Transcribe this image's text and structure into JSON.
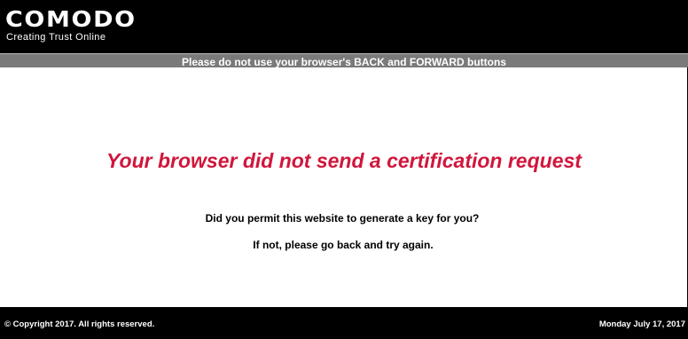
{
  "header": {
    "logo_text": "COMODO",
    "tagline": "Creating Trust Online"
  },
  "notice_bar": {
    "text": "Please do not use your browser's BACK and FORWARD buttons"
  },
  "main": {
    "error_title": "Your browser did not send a certification request",
    "question": "Did you permit this website to generate a key for you?",
    "instruction": "If not, please go back and try again."
  },
  "footer": {
    "copyright": "© Copyright 2017. All rights reserved.",
    "date": "Monday July 17, 2017"
  },
  "colors": {
    "background": "#000000",
    "content_background": "#ffffff",
    "notice_bar_background": "#7a7a7a",
    "error_title": "#d0163c",
    "text_light": "#ffffff",
    "text_dark": "#000000"
  }
}
